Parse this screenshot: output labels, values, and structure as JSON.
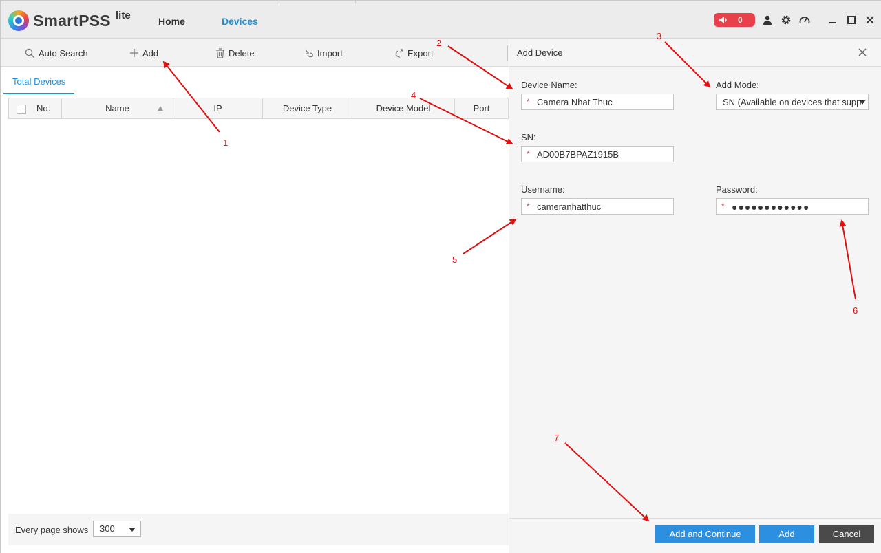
{
  "app": {
    "name": "SmartPSS",
    "suffix": "lite",
    "tabs": [
      {
        "label": "Home",
        "active": false
      },
      {
        "label": "Devices",
        "active": true
      }
    ],
    "alarm_count": "0",
    "alarm_color": "#e8414b",
    "accent_color": "#1e90d8"
  },
  "toolbar": {
    "auto_search": "Auto Search",
    "add": "Add",
    "delete": "Delete",
    "import": "Import",
    "export": "Export"
  },
  "list": {
    "tab": "Total Devices",
    "columns": [
      "No.",
      "Name",
      "IP",
      "Device Type",
      "Device Model",
      "Port"
    ],
    "rows": [],
    "pager_label": "Every page shows",
    "page_size": "300"
  },
  "dialog": {
    "title": "Add Device",
    "device_name_label": "Device Name:",
    "device_name_value": "Camera Nhat Thuc",
    "add_mode_label": "Add Mode:",
    "add_mode_value": "SN (Available on devices that supp",
    "sn_label": "SN:",
    "sn_value": "AD00B7BPAZ1915B",
    "username_label": "Username:",
    "username_value": "cameranhatthuc",
    "password_label": "Password:",
    "password_value": "●●●●●●●●●●●●",
    "required_mark": "*",
    "buttons": {
      "add_continue": "Add and Continue",
      "add": "Add",
      "cancel": "Cancel"
    }
  },
  "annotations": {
    "color": "#e01010",
    "labels": [
      "1",
      "2",
      "3",
      "4",
      "5",
      "6",
      "7"
    ]
  }
}
